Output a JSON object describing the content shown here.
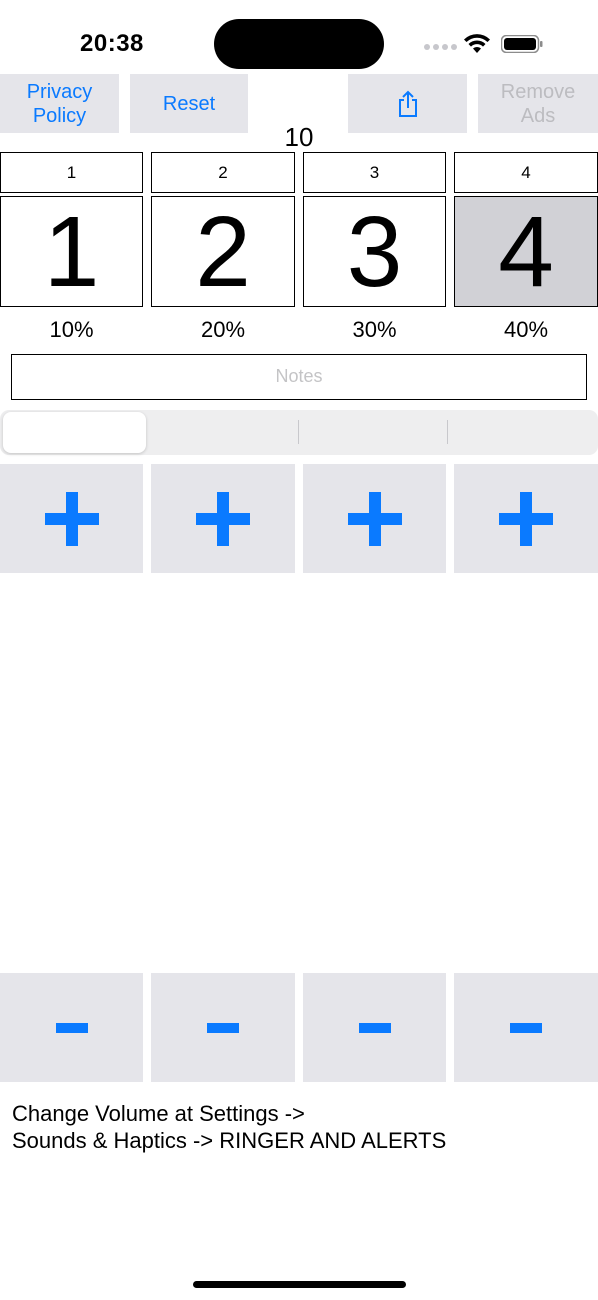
{
  "status_bar": {
    "time": "20:38"
  },
  "toolbar": {
    "privacy_policy": "Privacy\nPolicy",
    "reset": "Reset",
    "share_icon": "share-icon",
    "remove_ads": "Remove\nAds"
  },
  "total": "10",
  "columns": [
    {
      "label": "1",
      "value": "1",
      "percent": "10%"
    },
    {
      "label": "2",
      "value": "2",
      "percent": "20%"
    },
    {
      "label": "3",
      "value": "3",
      "percent": "30%"
    },
    {
      "label": "4",
      "value": "4",
      "percent": "40%"
    }
  ],
  "selected_column": 4,
  "notes": {
    "placeholder": "Notes"
  },
  "segmented_control": {
    "selected_index": 0,
    "segments": 4
  },
  "increment_icon": "plus-icon",
  "decrement_icon": "minus-icon",
  "info_text": "Change Volume at Settings ->\nSounds & Haptics -> RINGER AND ALERTS",
  "colors": {
    "accent": "#0a7aff",
    "button_bg": "#e5e5ea",
    "selected_cell": "#d1d1d6",
    "disabled_text": "#bcbcc0"
  }
}
